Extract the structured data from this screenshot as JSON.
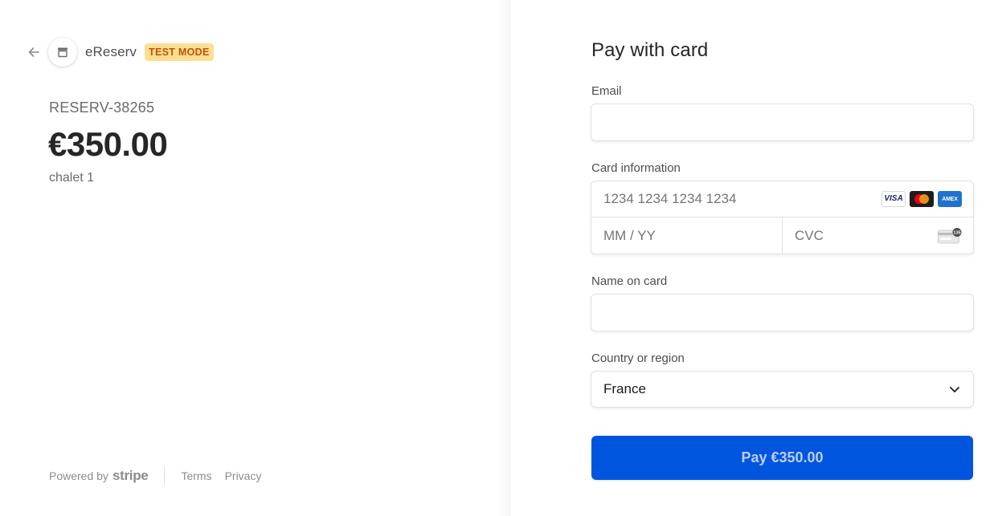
{
  "merchant": {
    "name": "eReserv",
    "badge": "TEST MODE"
  },
  "order": {
    "reference": "RESERV-38265",
    "amount": "€350.00",
    "product": "chalet 1"
  },
  "footer": {
    "powered_by": "Powered by",
    "stripe": "stripe",
    "terms": "Terms",
    "privacy": "Privacy"
  },
  "form": {
    "title": "Pay with card",
    "email": {
      "label": "Email",
      "value": "",
      "placeholder": ""
    },
    "card": {
      "label": "Card information",
      "number_placeholder": "1234 1234 1234 1234",
      "expiry_placeholder": "MM / YY",
      "cvc_placeholder": "CVC",
      "brands": [
        "visa-icon",
        "mastercard-icon",
        "amex-icon"
      ],
      "visa_text": "VISA",
      "amex_text": "AMEX",
      "cvc_hint": "135"
    },
    "name_on_card": {
      "label": "Name on card",
      "value": "",
      "placeholder": ""
    },
    "country": {
      "label": "Country or region",
      "value": "France"
    },
    "pay_button": "Pay €350.00"
  },
  "colors": {
    "accent": "#0055de",
    "badge_bg": "#ffde92",
    "badge_text": "#bb5504"
  }
}
